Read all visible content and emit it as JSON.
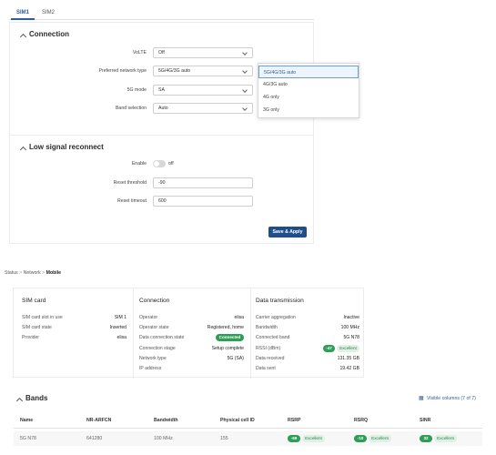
{
  "sim_tabs": [
    {
      "label": "SIM1",
      "active": true
    },
    {
      "label": "SIM2",
      "active": false
    }
  ],
  "connection_section": {
    "title": "Connection",
    "fields": {
      "volte": {
        "label": "VoLTE",
        "value": "Off"
      },
      "network_type": {
        "label": "Preferred network type",
        "value": "5G/4G/3G auto"
      },
      "fiveg_mode": {
        "label": "5G mode",
        "value": "SA"
      },
      "band_selection": {
        "label": "Band selection",
        "value": "Auto"
      }
    },
    "network_type_options": [
      "5G/4G/3G auto",
      "4G/3G auto",
      "4G only",
      "3G only"
    ]
  },
  "low_signal_section": {
    "title": "Low signal reconnect",
    "enable_label": "Enable",
    "enable_state": "off",
    "reset_threshold": {
      "label": "Reset threshold",
      "value": "-90"
    },
    "reset_timeout": {
      "label": "Reset timeout",
      "value": "600"
    }
  },
  "save_button_label": "Save & Apply",
  "breadcrumb": {
    "status": "Status",
    "network": "Network",
    "mobile": "Mobile"
  },
  "sim_card": {
    "title": "SIM card",
    "rows": [
      {
        "key": "SIM card slot in use",
        "value": "SIM 1"
      },
      {
        "key": "SIM card state",
        "value": "Inserted"
      },
      {
        "key": "Provider",
        "value": "elisa"
      }
    ]
  },
  "connection": {
    "title": "Connection",
    "rows": [
      {
        "key": "Operator",
        "value": "elisa"
      },
      {
        "key": "Operator state",
        "value": "Registered, home"
      },
      {
        "key": "Data connection state",
        "value": "Connected"
      },
      {
        "key": "Connection stage",
        "value": "Setup complete"
      },
      {
        "key": "Network type",
        "value": "5G (SA)"
      },
      {
        "key": "IP address",
        "value": ""
      }
    ]
  },
  "data_transmission": {
    "title": "Data transmission",
    "rows": [
      {
        "key": "Carrier aggregation",
        "value": "Inactive"
      },
      {
        "key": "Bandwidth",
        "value": "100 MHz"
      },
      {
        "key": "Connected band",
        "value": "5G N78"
      },
      {
        "key": "RSSI (dBm)",
        "value": "-47",
        "quality": "Excellent"
      },
      {
        "key": "Data received",
        "value": "131.35 GB"
      },
      {
        "key": "Data sent",
        "value": "19.42 GB"
      }
    ]
  },
  "bands": {
    "title": "Bands",
    "visible_columns_link": "Visible columns (7 of 7)",
    "columns": [
      "Name",
      "NR-ARFCN",
      "Bandwidth",
      "Physical cell ID",
      "RSRP",
      "RSRQ",
      "SINR"
    ],
    "row": {
      "name": "5G N78",
      "arfcn": "641280",
      "bandwidth": "100 MHz",
      "pci": "155",
      "rsrp": "-69",
      "rsrp_q": "Excellent",
      "rsrq": "-10",
      "rsrq_q": "Excellent",
      "sinr": "32",
      "sinr_q": "Excellent"
    }
  },
  "colors": {
    "accent": "#1f4e8c",
    "connected": "#2e9e57",
    "excellent_bg": "#dff1e5"
  }
}
